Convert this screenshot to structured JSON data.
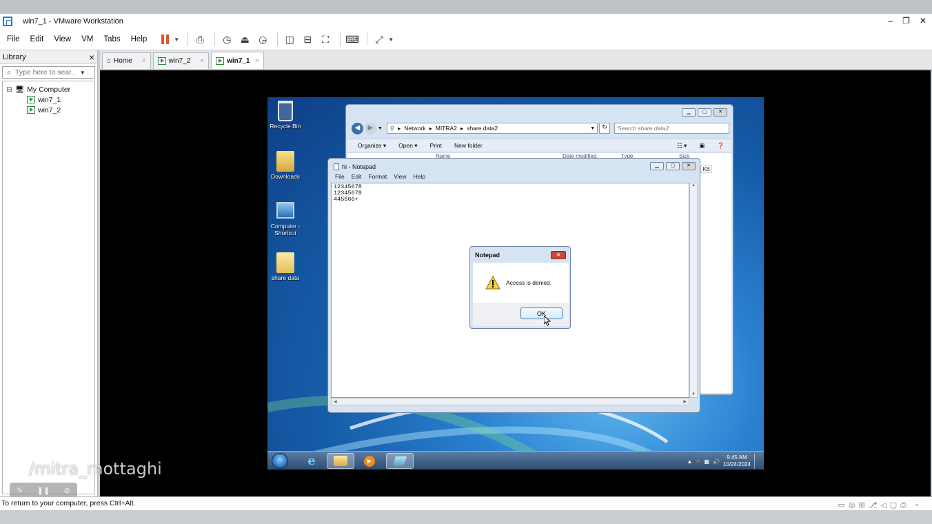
{
  "window": {
    "title": "win7_1 - VMware Workstation",
    "minimize": "–",
    "restore": "❐",
    "close": "✕"
  },
  "menu": [
    "File",
    "Edit",
    "View",
    "VM",
    "Tabs",
    "Help"
  ],
  "library": {
    "title": "Library",
    "close": "×",
    "search_placeholder": "Type here to sear...",
    "tree": {
      "root": "My Computer",
      "expander": "⊟",
      "items": [
        "win7_1",
        "win7_2"
      ]
    }
  },
  "tabs": [
    {
      "label": "Home",
      "close": "×"
    },
    {
      "label": "win7_2",
      "close": "×"
    },
    {
      "label": "win7_1",
      "close": "×"
    }
  ],
  "desktop": {
    "icons": [
      "Recycle Bin",
      "Downloads",
      "Computer - Shortcut",
      "share data"
    ]
  },
  "explorer": {
    "address": [
      "Network",
      "MITRA2",
      "share data2"
    ],
    "search_placeholder": "Search share data2",
    "commands": [
      "Organize ▾",
      "Open ▾",
      "Print",
      "New folder"
    ],
    "columns": [
      "Name",
      "Date modified",
      "Type",
      "Size"
    ],
    "size_unit": "KB"
  },
  "notepad": {
    "title": "hi - Notepad",
    "menu": [
      "File",
      "Edit",
      "Format",
      "View",
      "Help"
    ],
    "lines": [
      "12345678",
      "12345678",
      "445666+"
    ]
  },
  "dialog": {
    "title": "Notepad",
    "message": "Access is denied.",
    "ok_label": "OK"
  },
  "taskbar": {
    "time": "9:45 AM",
    "date": "10/24/2024"
  },
  "watermark": "/mitra_mottaghi",
  "status": {
    "message": "To return to your computer, press Ctrl+Alt."
  },
  "colors": {
    "accent_pause": "#e0552a",
    "vm_green": "#2e8a3f",
    "win_blue": "#155ca8"
  }
}
